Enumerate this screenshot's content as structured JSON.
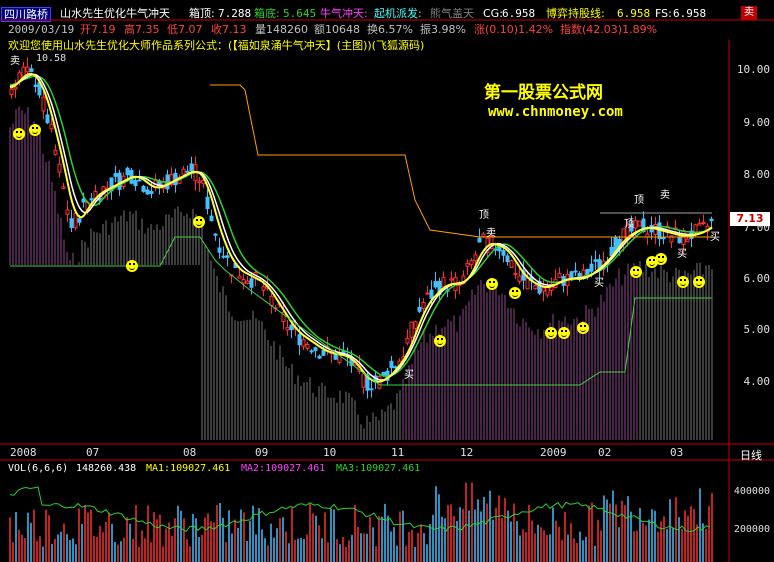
{
  "header": {
    "stock_name": "四川路桥",
    "formula_title": "山水先生优化牛气冲天",
    "box_top_label": "箱顶:",
    "box_top_value": "7.288",
    "box_bottom_label": "箱底:",
    "box_bottom_value": "5.645",
    "bull_label": "牛气冲天:",
    "start_label": "起机派发:",
    "bear_label": "熊气盖天",
    "cg_label": "CG:",
    "cg_value": "6.958",
    "bs_label": "博弈持股线:",
    "bs_value": "6.958",
    "fs_label": "FS:",
    "fs_value": "6.958",
    "top_icon": "卖"
  },
  "info_line": {
    "date": "2009/03/19",
    "open": "开7.19",
    "high": "高7.35",
    "low": "低7.07",
    "close": "收7.13",
    "volume": "量148260",
    "amount": "额10648",
    "turnover": "换6.57%",
    "amplitude": "振3.98%",
    "change": "涨(0.10)1.42%",
    "index": "指数(42.03)1.89%"
  },
  "welcome_line": "欢迎您使用山水先生优化大师作品系列公式：(【福如泉涌牛气冲天】(主图))(飞狐源码)",
  "watermark": {
    "line1": "第一股票公式网",
    "line2": "www.chnmoney.com"
  },
  "price_axis": [
    "10.00",
    "9.00",
    "8.00",
    "7.00",
    "6.00",
    "5.00",
    "4.00"
  ],
  "current_price_tag": "7.13",
  "peak_label": "10.58",
  "time_axis": [
    "2008",
    "07",
    "08",
    "09",
    "10",
    "11",
    "12",
    "2009",
    "02",
    "03"
  ],
  "period_button": "日线",
  "volume_panel": {
    "indicator": "VOL(6,6,6)",
    "vol_value": "148260.438",
    "ma1": "MA1:109027.461",
    "ma2": "MA2:109027.461",
    "ma3": "MA3:109027.461",
    "axis": [
      "400000",
      "200000"
    ]
  },
  "signals": {
    "sell": "卖",
    "buy": "买",
    "top": "顶"
  },
  "colors": {
    "up": "#ff3030",
    "down": "#40c0ff",
    "ma_yellow": "#ffff40",
    "ma_white": "#ffffff",
    "ma_green": "#30d030",
    "box_line": "#ffa000",
    "support_green": "#40d040",
    "hist_magenta": "#c060c0",
    "hist_gray": "#a0a0a0"
  }
}
